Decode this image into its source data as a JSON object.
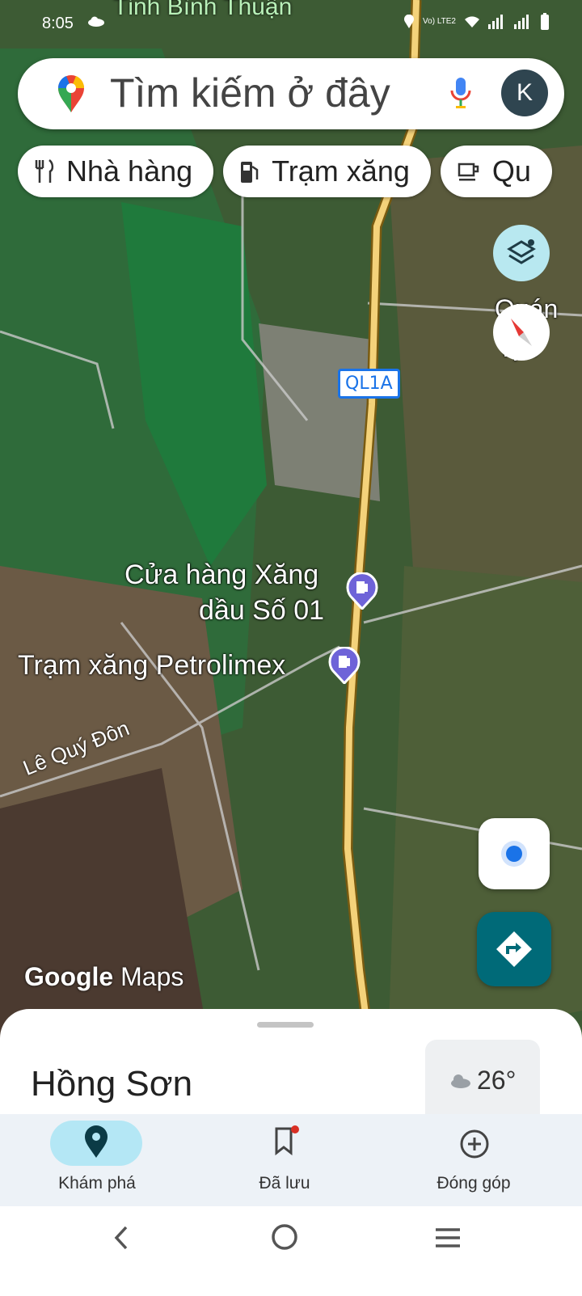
{
  "status_bar": {
    "time": "8:05",
    "network_label": "Vo) LTE2"
  },
  "map": {
    "region_label": "Tỉnh Bình Thuận",
    "road_badge": "QL1A",
    "street_label": "Lê Quý Đôn",
    "poi_1_line1": "Cửa hàng Xăng",
    "poi_1_line2": "dầu Số 01",
    "poi_2": "Trạm xăng Petrolimex",
    "partial_label_1": "Quán",
    "partial_label_2": "lực",
    "watermark_google": "Google",
    "watermark_maps": "Maps"
  },
  "search": {
    "placeholder": "Tìm kiếm ở đây",
    "avatar_letter": "K"
  },
  "chips": [
    {
      "label": "Nhà hàng",
      "icon": "restaurant-icon"
    },
    {
      "label": "Trạm xăng",
      "icon": "gas-station-icon"
    },
    {
      "label": "Qu",
      "icon": "coffee-icon"
    }
  ],
  "sheet": {
    "place_name": "Hồng Sơn",
    "temperature": "26°"
  },
  "bottom_nav": [
    {
      "label": "Khám phá",
      "icon": "location-pin-icon",
      "active": true
    },
    {
      "label": "Đã lưu",
      "icon": "bookmark-icon",
      "active": false
    },
    {
      "label": "Đóng góp",
      "icon": "add-circle-icon",
      "active": false
    }
  ],
  "colors": {
    "accent": "#1a73e8",
    "directions": "#006a78",
    "active_nav": "#b4e7f5"
  }
}
